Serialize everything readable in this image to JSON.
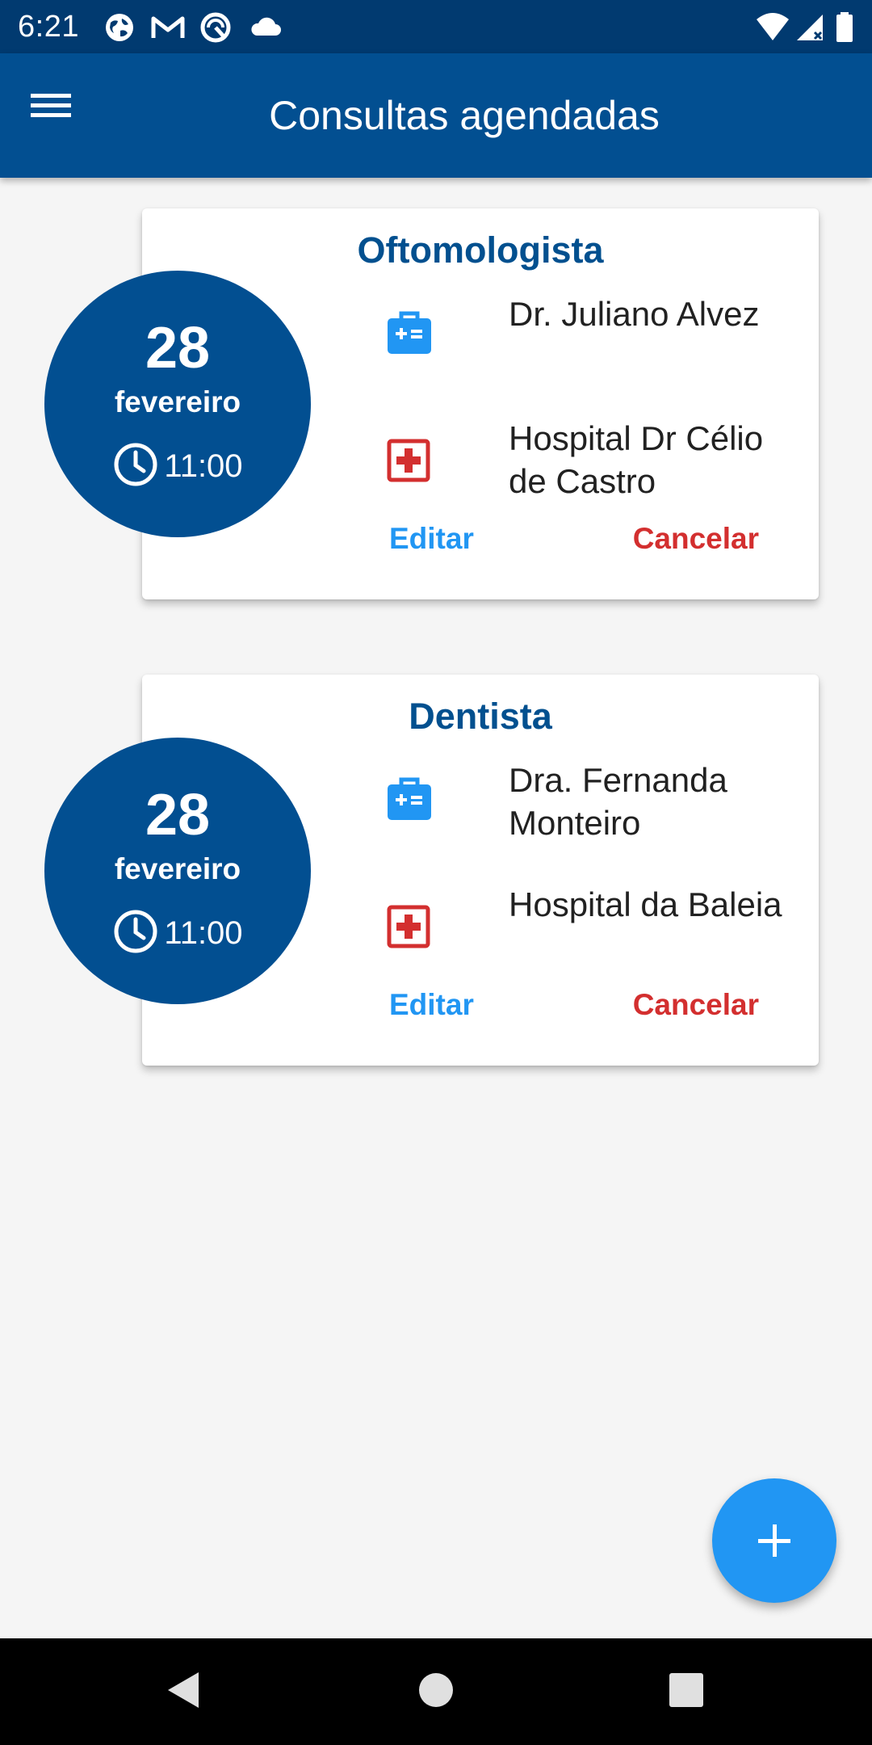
{
  "status_bar": {
    "time": "6:21",
    "notification_icons": [
      "globe-icon",
      "gmail-icon",
      "app-icon",
      "cloud-icon"
    ],
    "system_icons": [
      "wifi-icon",
      "signal-icon",
      "battery-icon"
    ]
  },
  "app_bar": {
    "title": "Consultas agendadas",
    "menu_icon": "menu-icon"
  },
  "appointments": [
    {
      "specialty": "Oftomologista",
      "day": "28",
      "month": "fevereiro",
      "time": "11:00",
      "doctor": "Dr. Juliano Alvez",
      "hospital": "Hospital Dr Célio de Castro",
      "edit_label": "Editar",
      "cancel_label": "Cancelar"
    },
    {
      "specialty": "Dentista",
      "day": "28",
      "month": "fevereiro",
      "time": "11:00",
      "doctor": "Dra. Fernanda Monteiro",
      "hospital": "Hospital da Baleia",
      "edit_label": "Editar",
      "cancel_label": "Cancelar"
    }
  ],
  "fab": {
    "icon": "plus-icon"
  },
  "nav_bar": {
    "buttons": [
      "back-icon",
      "home-icon",
      "recents-icon"
    ]
  },
  "colors": {
    "status_bar": "#013a70",
    "primary": "#024f91",
    "accent": "#2196f3",
    "cancel": "#d32f2f",
    "background": "#f5f5f5"
  }
}
